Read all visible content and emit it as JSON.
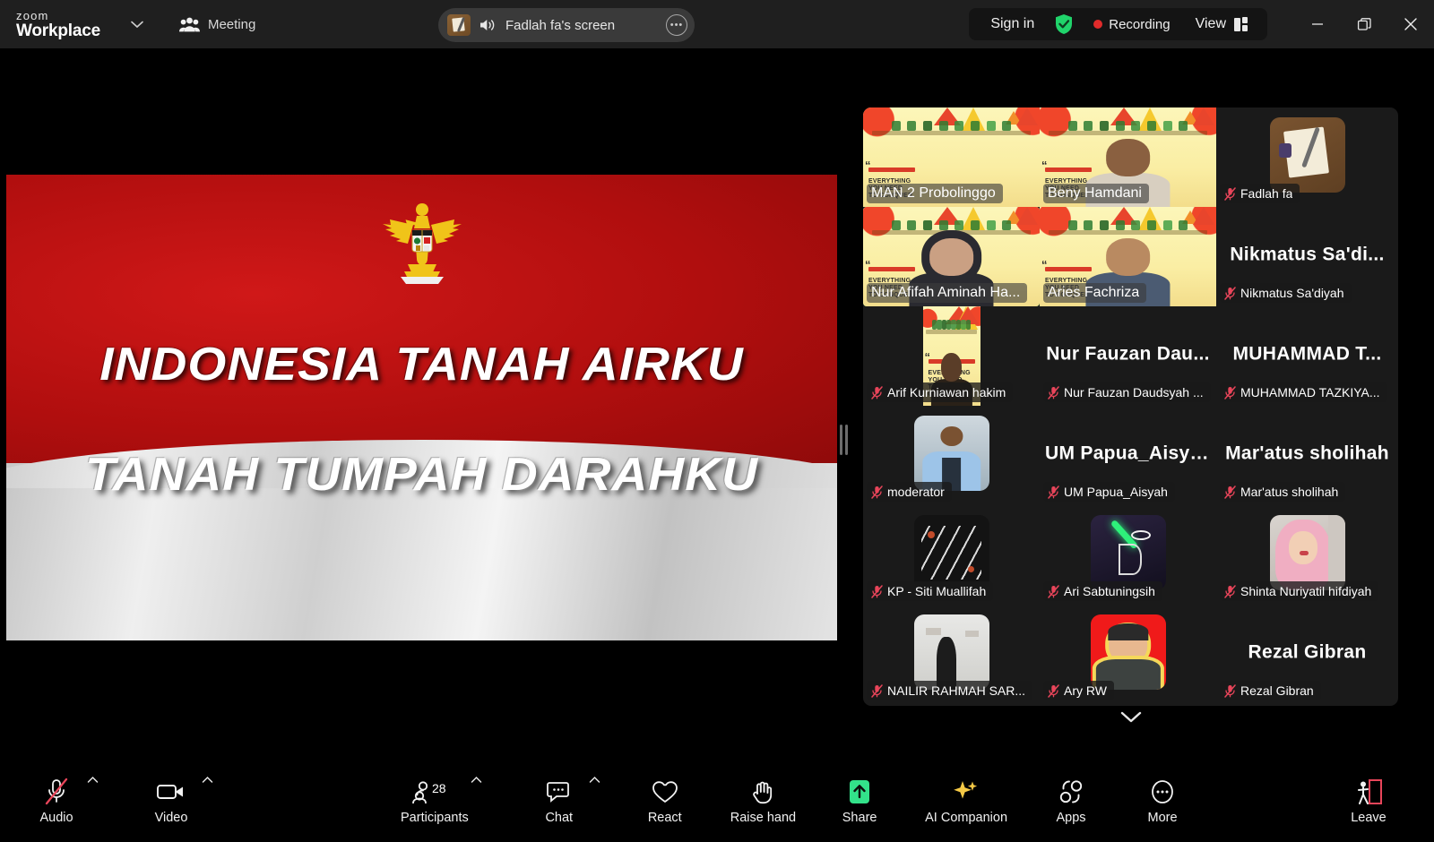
{
  "app": {
    "brand_top": "zoom",
    "brand_bottom": "Workplace",
    "meeting_label": "Meeting",
    "accent_green": "#3ff07a",
    "record_red": "#e02b2b",
    "mute_red": "#e8455a"
  },
  "titlebar": {
    "sharing_pill": {
      "label": "Fadlah fa's screen",
      "speaker_icon": "speaker-icon",
      "more_icon": "more-options-icon",
      "thumb_icon": "screen-thumbnail-icon"
    },
    "sign_in": "Sign in",
    "shield_icon": "security-shield-icon",
    "recording_label": "Recording",
    "view_label": "View",
    "view_icon": "layout-view-icon",
    "minimize_icon": "minimize-icon",
    "restore_icon": "restore-window-icon",
    "close_icon": "close-icon",
    "dropdown_icon": "chevron-down-icon",
    "meeting_icon": "people-group-icon"
  },
  "shared_screen": {
    "line1": "INDONESIA TANAH AIRKU",
    "line2": "TANAH TUMPAH DARAHKU",
    "emblem": "garuda-pancasila-emblem"
  },
  "panel": {
    "scroll_down_icon": "chevron-down-icon",
    "tiles": [
      {
        "name": "MAN 2 Probolinggo",
        "kind": "video",
        "muted": false,
        "active": false,
        "bigname": ""
      },
      {
        "name": "Beny Hamdani",
        "kind": "video",
        "muted": false,
        "active": false,
        "bigname": ""
      },
      {
        "name": "Fadlah fa",
        "kind": "avatar",
        "muted": true,
        "active": false,
        "bigname": ""
      },
      {
        "name": "Nur Afifah Aminah Ha...",
        "kind": "video",
        "muted": false,
        "active": true,
        "bigname": ""
      },
      {
        "name": "Aries Fachriza",
        "kind": "video",
        "muted": false,
        "active": false,
        "bigname": ""
      },
      {
        "name": "Nikmatus Sa'diyah",
        "kind": "nameonly",
        "muted": true,
        "active": false,
        "bigname": "Nikmatus  Sa'di..."
      },
      {
        "name": "Arif Kurniawan hakim",
        "kind": "video-tall",
        "muted": true,
        "active": false,
        "bigname": ""
      },
      {
        "name": "Nur Fauzan Daudsyah ...",
        "kind": "nameonly",
        "muted": true,
        "active": false,
        "bigname": "Nur Fauzan Dau..."
      },
      {
        "name": "MUHAMMAD TAZKIYA...",
        "kind": "nameonly",
        "muted": true,
        "active": false,
        "bigname": "MUHAMMAD T..."
      },
      {
        "name": "moderator",
        "kind": "avatar",
        "muted": true,
        "active": false,
        "bigname": ""
      },
      {
        "name": "UM Papua_Aisyah",
        "kind": "nameonly",
        "muted": true,
        "active": false,
        "bigname": "UM Papua_Aisyah"
      },
      {
        "name": "Mar'atus sholihah",
        "kind": "nameonly",
        "muted": true,
        "active": false,
        "bigname": "Mar'atus sholihah"
      },
      {
        "name": "KP - Siti Muallifah",
        "kind": "avatar",
        "muted": true,
        "active": false,
        "bigname": ""
      },
      {
        "name": "Ari Sabtuningsih",
        "kind": "avatar",
        "muted": true,
        "active": false,
        "bigname": ""
      },
      {
        "name": "Shinta Nuriyatil hifdiyah",
        "kind": "avatar",
        "muted": true,
        "active": false,
        "bigname": ""
      },
      {
        "name": "NAILIR RAHMAH SAR...",
        "kind": "avatar",
        "muted": true,
        "active": false,
        "bigname": ""
      },
      {
        "name": "Ary RW",
        "kind": "avatar",
        "muted": true,
        "active": false,
        "bigname": ""
      },
      {
        "name": "Rezal Gibran",
        "kind": "nameonly",
        "muted": true,
        "active": false,
        "bigname": "Rezal Gibran"
      }
    ]
  },
  "toolbar": {
    "audio": {
      "label": "Audio",
      "icon": "microphone-muted-icon",
      "has_caret": true,
      "muted": true
    },
    "video": {
      "label": "Video",
      "icon": "camera-icon",
      "has_caret": true
    },
    "participants": {
      "label": "Participants",
      "icon": "people-icon",
      "has_caret": true,
      "count": "28"
    },
    "chat": {
      "label": "Chat",
      "icon": "chat-bubble-icon",
      "has_caret": true
    },
    "react": {
      "label": "React",
      "icon": "heart-icon",
      "has_caret": false
    },
    "raise_hand": {
      "label": "Raise hand",
      "icon": "raised-hand-icon",
      "has_caret": false
    },
    "share": {
      "label": "Share",
      "icon": "share-screen-icon",
      "has_caret": false
    },
    "ai_companion": {
      "label": "AI Companion",
      "icon": "sparkle-icon",
      "has_caret": false
    },
    "apps": {
      "label": "Apps",
      "icon": "apps-icon",
      "has_caret": false
    },
    "more": {
      "label": "More",
      "icon": "more-horizontal-icon",
      "has_caret": false
    },
    "leave": {
      "label": "Leave",
      "icon": "leave-door-icon",
      "has_caret": false
    }
  }
}
